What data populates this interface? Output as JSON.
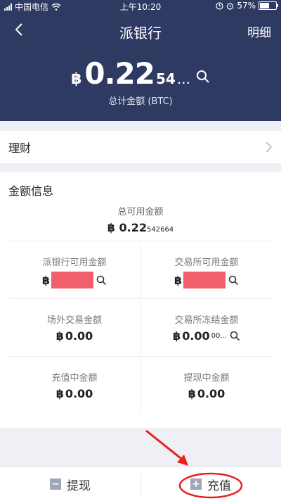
{
  "status_bar": {
    "carrier": "中国电信",
    "time": "上午10:20",
    "battery": "57%",
    "battery_level": 0.57
  },
  "nav": {
    "title": "派银行",
    "right_label": "明细"
  },
  "balance": {
    "symbol": "฿",
    "main": "0.22",
    "rest": "54",
    "ellipsis": "...",
    "label": "总计金额 (BTC)"
  },
  "finance": {
    "label": "理财"
  },
  "amount_info": {
    "title": "金额信息",
    "total_label": "总可用金额",
    "total_symbol": "฿",
    "total_main": "0.22",
    "total_small": "542664",
    "cells": [
      {
        "label": "派银行可用金额",
        "symbol": "฿"
      },
      {
        "label": "交易所可用金额",
        "symbol": "฿"
      },
      {
        "label": "场外交易金额",
        "symbol": "฿",
        "value": "0.00"
      },
      {
        "label": "交易所冻结金额",
        "symbol": "฿",
        "value": "0.00",
        "small": "00..."
      },
      {
        "label": "充值中金额",
        "symbol": "฿",
        "value": "0.00"
      },
      {
        "label": "提现中金额",
        "symbol": "฿",
        "value": "0.00"
      }
    ]
  },
  "bottom": {
    "withdraw_label": "提现",
    "withdraw_icon": "minus-square-icon",
    "deposit_label": "充值",
    "deposit_icon": "plus-square-icon"
  },
  "colors": {
    "header_bg": "#2f3a63",
    "redaction": "#f0606a",
    "annotation": "#e8211c"
  }
}
